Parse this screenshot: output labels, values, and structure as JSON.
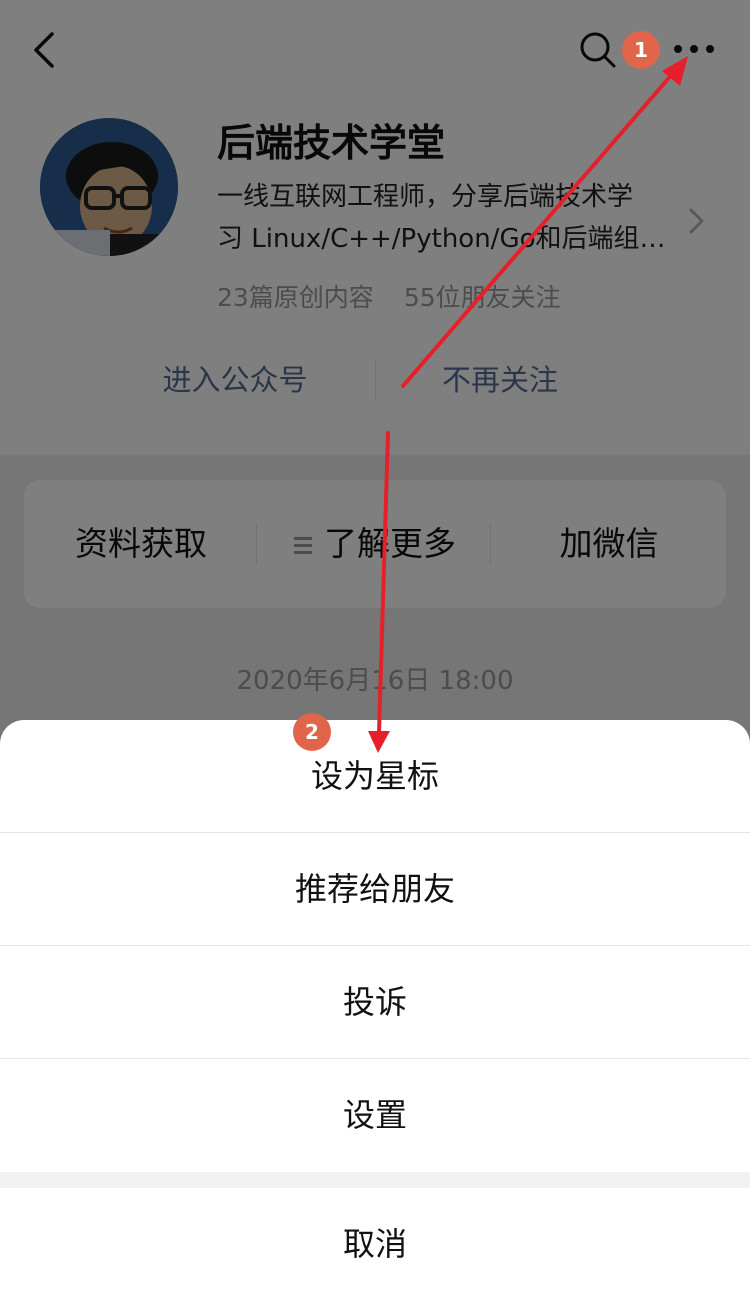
{
  "account": {
    "name": "后端技术学堂",
    "description_line1": "一线互联网工程师，分享后端技术学",
    "description_line2": "习 Linux/C++/Python/Go和后端组…",
    "original_count": "23篇原创内容",
    "friends_following": "55位朋友关注"
  },
  "actions": {
    "enter": "进入公众号",
    "unfollow": "不再关注"
  },
  "menu": {
    "items": [
      "资料获取",
      "了解更多",
      "加微信"
    ]
  },
  "date": "2020年6月16日 18:00",
  "sheet": {
    "items": [
      "设为星标",
      "推荐给朋友",
      "投诉",
      "设置"
    ],
    "cancel": "取消"
  },
  "badges": {
    "step1": "1",
    "step2": "2"
  },
  "icons": [
    "back-icon",
    "search-icon",
    "more-icon",
    "chevron-right-icon",
    "list-icon",
    "avatar"
  ],
  "colors": {
    "link": "#576b95",
    "badge": "#e0654a",
    "arrow": "#e5202a",
    "overlay": "rgba(0,0,0,0.5)"
  }
}
